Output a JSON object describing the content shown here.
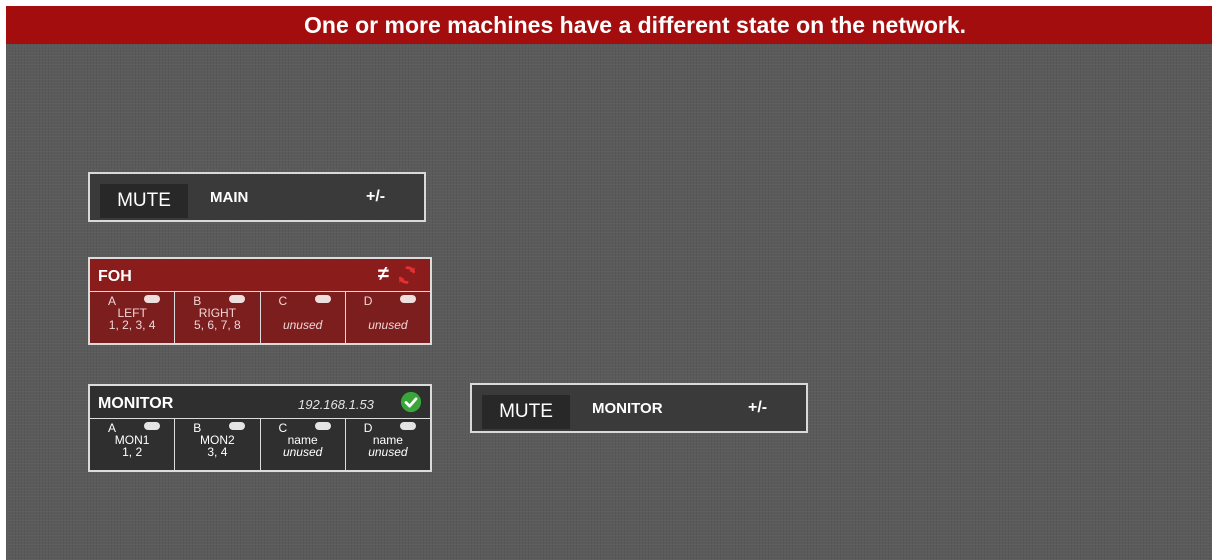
{
  "banner": {
    "message": "One or more machines have a different state on the network."
  },
  "faders": [
    {
      "mute_label": "MUTE",
      "name": "MAIN",
      "adjust_label": "+/-"
    },
    {
      "mute_label": "MUTE",
      "name": "MONITOR",
      "adjust_label": "+/-"
    }
  ],
  "machines": [
    {
      "name": "FOH",
      "status_symbol": "≠",
      "status_icon": "sync-icon",
      "status_color": "#e53030",
      "outputs": [
        {
          "letter": "A",
          "label": "LEFT",
          "channels": "1, 2, 3, 4"
        },
        {
          "letter": "B",
          "label": "RIGHT",
          "channels": "5, 6, 7, 8"
        },
        {
          "letter": "C",
          "label": "",
          "channels": "unused"
        },
        {
          "letter": "D",
          "label": "",
          "channels": "unused"
        }
      ]
    },
    {
      "name": "MONITOR",
      "ip": "192.168.1.53",
      "status_icon": "check-icon",
      "status_color": "#3aa63a",
      "outputs": [
        {
          "letter": "A",
          "label": "MON1",
          "channels": "1, 2"
        },
        {
          "letter": "B",
          "label": "MON2",
          "channels": "3, 4"
        },
        {
          "letter": "C",
          "label": "name",
          "channels": "unused"
        },
        {
          "letter": "D",
          "label": "name",
          "channels": "unused"
        }
      ]
    }
  ],
  "colors": {
    "banner": "#a30d0d",
    "background": "#5b5b5b",
    "foh_card": "#8a1c1c",
    "monitor_card": "#2f2f2f"
  }
}
